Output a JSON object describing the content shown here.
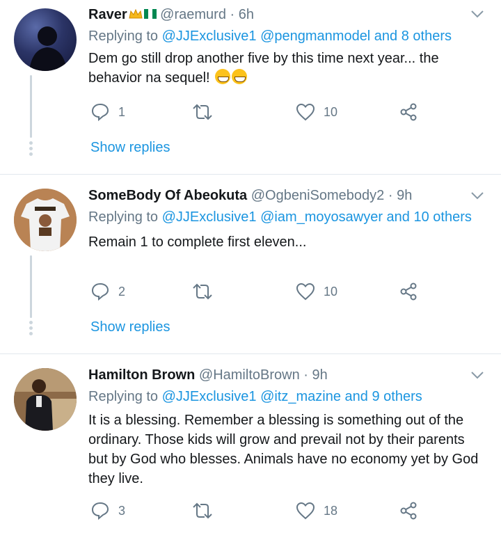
{
  "tweets": [
    {
      "name": "Raver",
      "handle": "@raemurd",
      "dot": "·",
      "time": "6h",
      "replying_prefix": "Replying to",
      "replying_links": "@JJExclusive1 @pengmanmodel and 8 others",
      "text": "Dem go still drop another five by this time next year... the behavior na sequel!",
      "reply_count": "1",
      "like_count": "10",
      "show_replies": "Show replies",
      "avatar_icon": "avatar-silhouette-night-sky"
    },
    {
      "name": "SomeBody Of Abeokuta",
      "handle": "@OgbeniSomebody2",
      "dot": "·",
      "time": "9h",
      "replying_prefix": "Replying to",
      "replying_links": "@JJExclusive1 @iam_moyosawyer and 10 others",
      "text": "Remain 1 to complete first eleven...",
      "reply_count": "2",
      "like_count": "10",
      "show_replies": "Show replies",
      "avatar_icon": "avatar-tshirt-somebody"
    },
    {
      "name": "Hamilton Brown",
      "handle": "@HamiltoBrown",
      "dot": "·",
      "time": "9h",
      "replying_prefix": "Replying to",
      "replying_links": "@JJExclusive1 @itz_mazine and 9 others",
      "text": "It is a blessing. Remember a blessing is something out of the ordinary. Those kids will grow and prevail not by their parents but by God who blesses.  Animals have no economy yet by God they live.",
      "reply_count": "3",
      "like_count": "18",
      "avatar_icon": "avatar-man-in-suit"
    }
  ],
  "colors": {
    "link": "#1b95e0",
    "muted": "#657786",
    "text": "#14171a",
    "divider": "#e1e8ed"
  }
}
